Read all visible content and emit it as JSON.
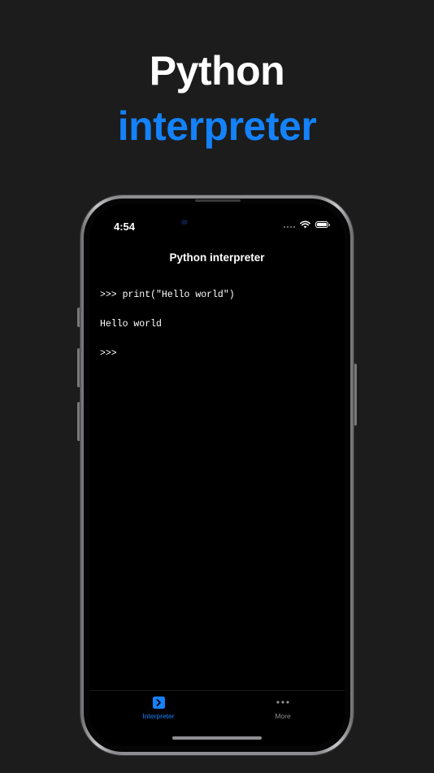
{
  "promo": {
    "headline_line1": "Python",
    "headline_line2": "interpreter"
  },
  "status_bar": {
    "time": "4:54",
    "wifi_icon": "wifi-icon",
    "battery_icon": "battery-icon",
    "battery_level": 1.0
  },
  "nav": {
    "title": "Python interpreter"
  },
  "console": {
    "lines": [
      ">>> print(\"Hello world\")",
      "Hello world",
      ">>>"
    ]
  },
  "tabbar": {
    "tabs": [
      {
        "label": "Interpreter",
        "icon": "terminal-icon",
        "selected": true
      },
      {
        "label": "More",
        "icon": "more-icon",
        "selected": false
      }
    ]
  },
  "colors": {
    "background": "#1c1c1d",
    "accent": "#1482fa",
    "headline": "#ffffff",
    "screen": "#000000",
    "inactive_tab": "#8e8e93"
  }
}
